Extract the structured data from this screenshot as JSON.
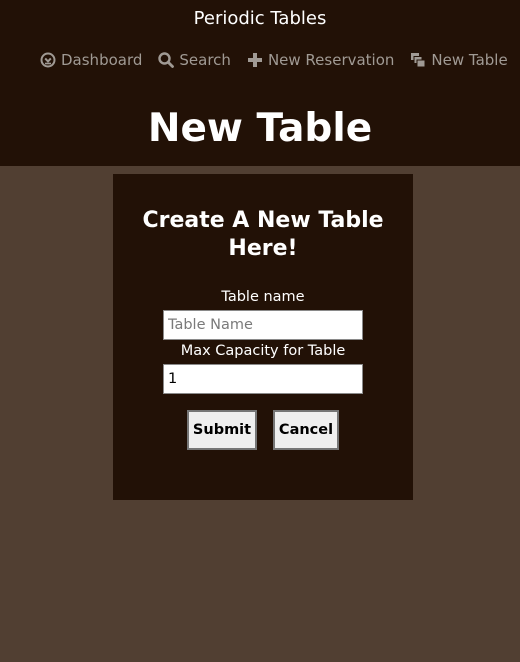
{
  "app": {
    "title": "Periodic Tables"
  },
  "nav": {
    "items": [
      {
        "label": "Dashboard",
        "icon": "dashboard-icon"
      },
      {
        "label": "Search",
        "icon": "search-icon"
      },
      {
        "label": "New Reservation",
        "icon": "plus-icon"
      },
      {
        "label": "New Table",
        "icon": "layers-icon"
      }
    ]
  },
  "page": {
    "title": "New Table"
  },
  "form": {
    "heading": "Create A New Table Here!",
    "table_name_label": "Table name",
    "table_name_placeholder": "Table Name",
    "table_name_value": "",
    "capacity_label": "Max Capacity for Table",
    "capacity_value": "1",
    "submit_label": "Submit",
    "cancel_label": "Cancel"
  },
  "colors": {
    "background": "#513f32",
    "header": "#221106",
    "nav_text": "#a09a94",
    "text": "#ffffff"
  }
}
